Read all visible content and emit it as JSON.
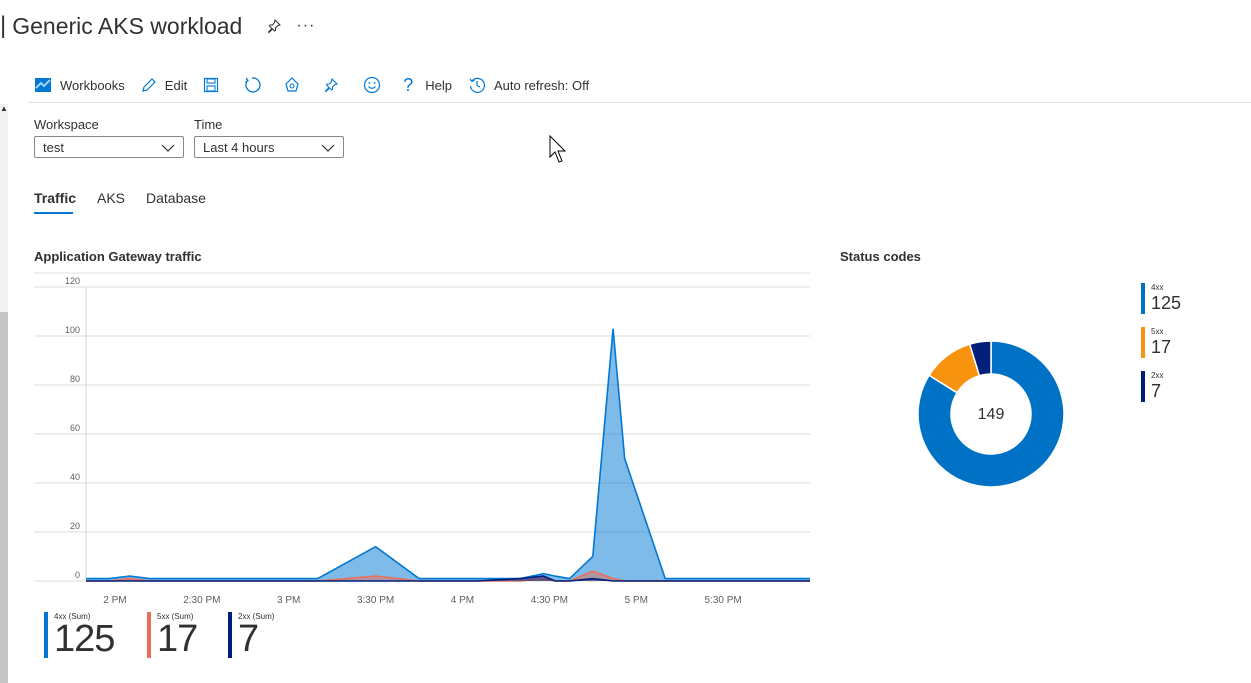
{
  "header": {
    "separator": "|",
    "title": "Generic AKS workload",
    "pin_icon": "pin-icon",
    "more_label": "···"
  },
  "toolbar": {
    "workbooks_label": "Workbooks",
    "edit_label": "Edit",
    "help_label": "Help",
    "auto_refresh_label": "Auto refresh: Off",
    "icons": [
      "workbooks-icon",
      "edit-icon",
      "save-icon",
      "refresh-icon",
      "customize-icon",
      "pin-icon",
      "feedback-icon",
      "help-icon",
      "history-icon"
    ],
    "accent": "#0078d4"
  },
  "parameters": {
    "workspace": {
      "label": "Workspace",
      "value": "test"
    },
    "time": {
      "label": "Time",
      "value": "Last 4 hours"
    }
  },
  "tabs": [
    {
      "label": "Traffic",
      "selected": true
    },
    {
      "label": "AKS",
      "selected": false
    },
    {
      "label": "Database",
      "selected": false
    }
  ],
  "traffic_section": {
    "title": "Application Gateway traffic"
  },
  "status_section": {
    "title": "Status codes"
  },
  "chart_data": [
    {
      "type": "area",
      "title": "Application Gateway traffic",
      "xlabel": "",
      "ylabel": "",
      "ylim": [
        0,
        120
      ],
      "y_ticks": [
        "120",
        "100",
        "80",
        "60",
        "40",
        "20",
        "0"
      ],
      "x_tick_labels": [
        "2 PM",
        "2:30 PM",
        "3 PM",
        "3:30 PM",
        "4 PM",
        "4:30 PM",
        "5 PM",
        "5:30 PM"
      ],
      "x": [
        "13:50",
        "13:58",
        "14:05",
        "14:12",
        "14:20",
        "15:10",
        "15:30",
        "15:45",
        "16:05",
        "16:20",
        "16:28",
        "16:32",
        "16:37",
        "16:45",
        "16:52",
        "16:56",
        "17:10",
        "17:30",
        "17:45",
        "18:00"
      ],
      "series": [
        {
          "name": "4xx (Sum)",
          "color": "#0078d4",
          "values": [
            1,
            1,
            2,
            1,
            1,
            1,
            14,
            1,
            1,
            1,
            3,
            2,
            1,
            10,
            103,
            50,
            1,
            1,
            1,
            1
          ]
        },
        {
          "name": "5xx (Sum)",
          "color": "#e8705a",
          "values": [
            0,
            0,
            1,
            0,
            0,
            0,
            2,
            0,
            0,
            0,
            1,
            0,
            0,
            4,
            1,
            0,
            0,
            0,
            0,
            0
          ]
        },
        {
          "name": "2xx (Sum)",
          "color": "#001f7a",
          "values": [
            0,
            0,
            0,
            0,
            0,
            0,
            0,
            0,
            0,
            1,
            2,
            0,
            0,
            1,
            0,
            0,
            0,
            0,
            0,
            0
          ]
        }
      ],
      "grid": true,
      "summary": [
        {
          "label": "4xx (Sum)",
          "value": "125",
          "color": "#0078d4"
        },
        {
          "label": "5xx (Sum)",
          "value": "17",
          "color": "#e8705a"
        },
        {
          "label": "2xx (Sum)",
          "value": "7",
          "color": "#001f7a"
        }
      ]
    },
    {
      "type": "pie",
      "title": "Status codes",
      "center_label": "149",
      "slices": [
        {
          "label": "4xx",
          "value": 125,
          "display": "125",
          "color": "#0072c6"
        },
        {
          "label": "5xx",
          "value": 17,
          "display": "17",
          "color": "#f7930e"
        },
        {
          "label": "2xx",
          "value": 7,
          "display": "7",
          "color": "#001f7a"
        }
      ],
      "legend_position": "right"
    }
  ]
}
